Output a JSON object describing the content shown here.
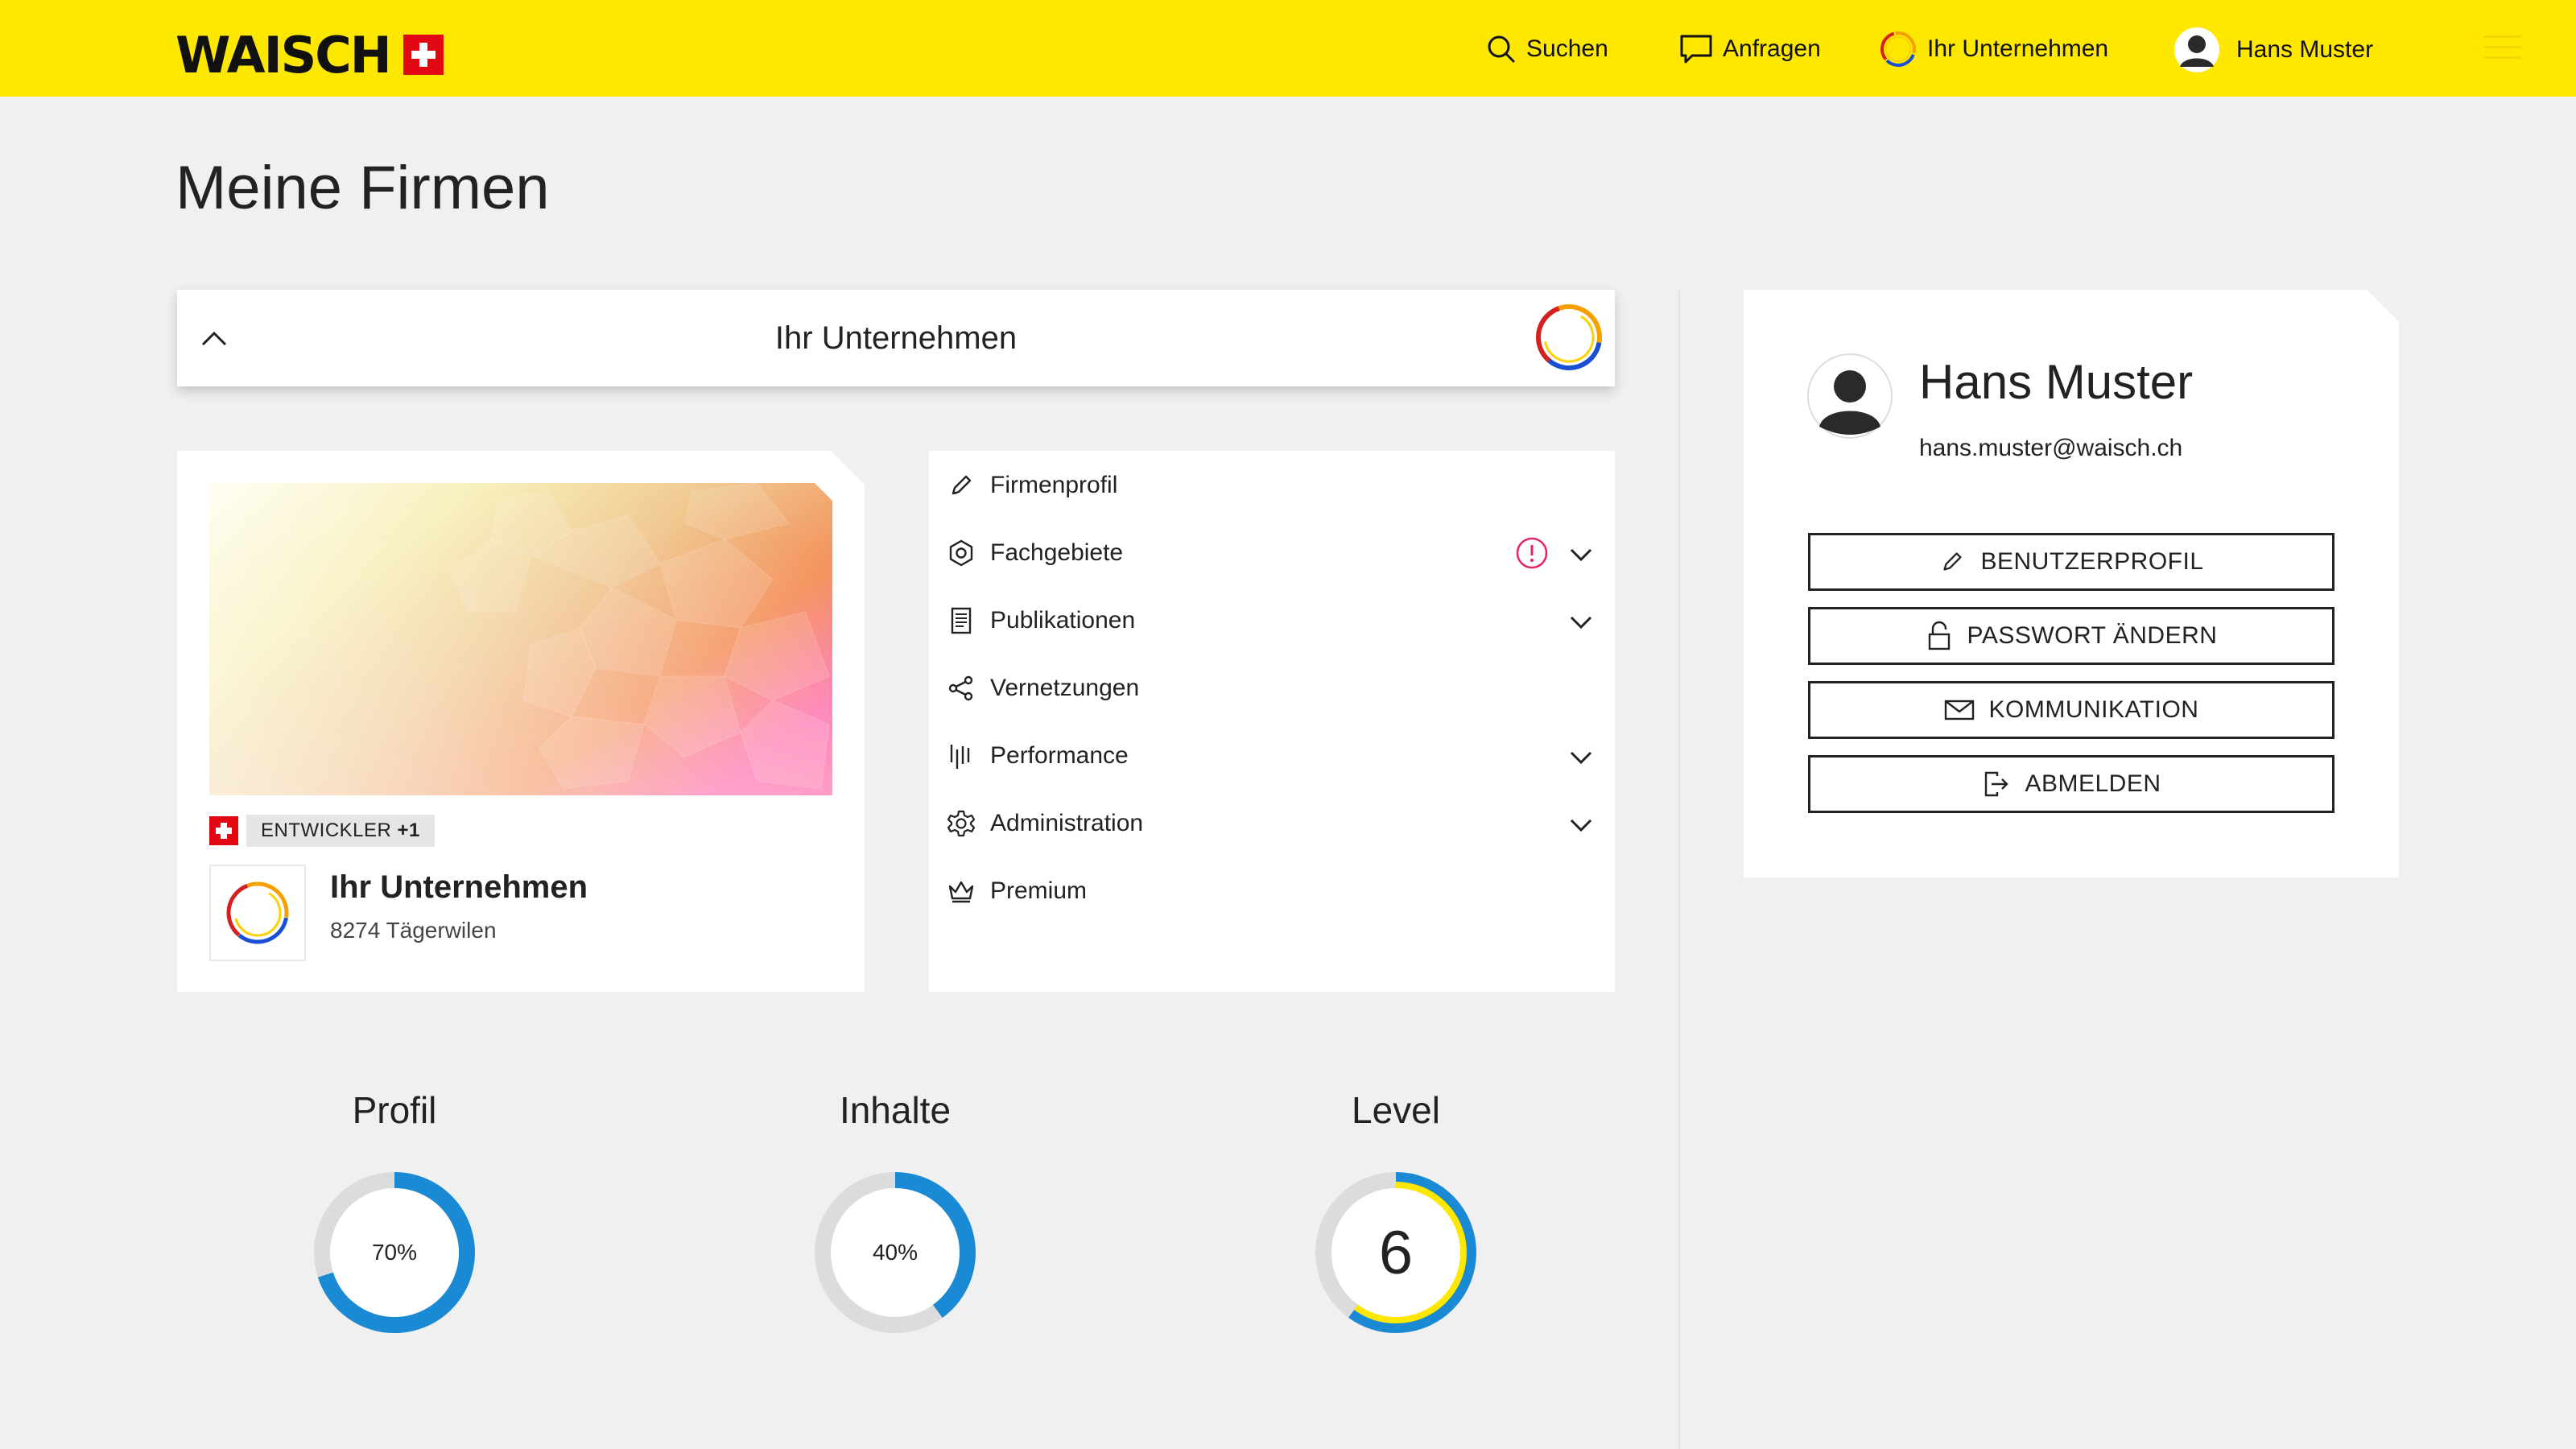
{
  "header": {
    "logo_text": "WAISCH",
    "nav": {
      "search": "Suchen",
      "requests": "Anfragen",
      "company": "Ihr Unternehmen",
      "user": "Hans Muster"
    }
  },
  "page": {
    "title": "Meine Firmen"
  },
  "accordion": {
    "title": "Ihr Unternehmen"
  },
  "company_card": {
    "tag": "ENTWICKLER",
    "tag_extra": "+1",
    "name": "Ihr Unternehmen",
    "location": "8274 Tägerwilen"
  },
  "menu": {
    "items": [
      {
        "label": "Firmenprofil",
        "icon": "pencil-icon",
        "expandable": false
      },
      {
        "label": "Fachgebiete",
        "icon": "hexagon-icon",
        "expandable": true,
        "alert": true
      },
      {
        "label": "Publikationen",
        "icon": "document-icon",
        "expandable": true
      },
      {
        "label": "Vernetzungen",
        "icon": "share-icon",
        "expandable": false
      },
      {
        "label": "Performance",
        "icon": "bars-icon",
        "expandable": true
      },
      {
        "label": "Administration",
        "icon": "gear-icon",
        "expandable": true
      },
      {
        "label": "Premium",
        "icon": "crown-icon",
        "expandable": false
      }
    ]
  },
  "user": {
    "name": "Hans Muster",
    "email": "hans.muster@waisch.ch",
    "buttons": {
      "profile": "BENUTZERPROFIL",
      "password": "PASSWORT ÄNDERN",
      "communication": "KOMMUNIKATION",
      "logout": "ABMELDEN"
    }
  },
  "stats": {
    "profile": {
      "title": "Profil",
      "value": 70,
      "label": "70%"
    },
    "content": {
      "title": "Inhalte",
      "value": 40,
      "label": "40%"
    },
    "level": {
      "title": "Level",
      "value": 6,
      "progress": 60
    }
  },
  "colors": {
    "brand_yellow": "#ffe800",
    "ring_blue": "#1a8ad4",
    "ring_yellow": "#ffe800",
    "ring_track": "#dcdcdc",
    "alert_pink": "#e5245e",
    "swiss_red": "#e30613"
  }
}
